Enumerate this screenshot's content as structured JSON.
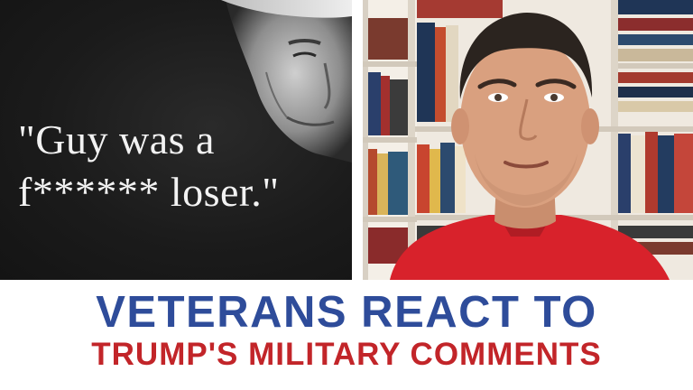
{
  "quote": {
    "line1": "\"Guy was a",
    "line2": "f****** loser.\""
  },
  "headline": {
    "line1": "VETERANS REACT TO",
    "line2": "TRUMP'S MILITARY COMMENTS"
  },
  "colors": {
    "headline_blue": "#2e4c9a",
    "headline_red": "#c22529",
    "left_panel_bg": "#1b1b1b"
  }
}
